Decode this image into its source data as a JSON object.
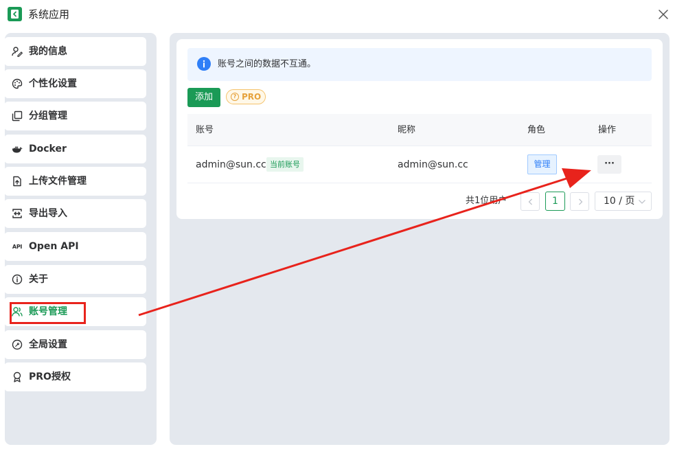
{
  "window": {
    "title": "系统应用",
    "close_icon": "close-icon",
    "logo_icon": "app-logo-icon"
  },
  "sidebar": {
    "items": [
      {
        "label": "我的信息",
        "icon": "user-edit-icon",
        "active": false
      },
      {
        "label": "个性化设置",
        "icon": "palette-icon",
        "active": false
      },
      {
        "label": "分组管理",
        "icon": "copy-icon",
        "active": false
      },
      {
        "label": "Docker",
        "icon": "docker-icon",
        "active": false
      },
      {
        "label": "上传文件管理",
        "icon": "upload-file-icon",
        "active": false
      },
      {
        "label": "导出导入",
        "icon": "export-import-icon",
        "active": false
      },
      {
        "label": "Open API",
        "icon": "api-icon",
        "icon_text": "API",
        "active": false
      },
      {
        "label": "关于",
        "icon": "info-icon",
        "active": false
      },
      {
        "label": "账号管理",
        "icon": "users-icon",
        "active": true
      },
      {
        "label": "全局设置",
        "icon": "wrench-icon",
        "active": false
      },
      {
        "label": "PRO授权",
        "icon": "award-icon",
        "active": false
      }
    ]
  },
  "main": {
    "notice": "账号之间的数据不互通。",
    "add_button": "添加",
    "pro_badge": "PRO",
    "pro_badge_icon_text": "?",
    "table": {
      "headers": [
        "账号",
        "昵称",
        "角色",
        "操作"
      ],
      "rows": [
        {
          "account": "admin@sun.cc",
          "current_tag": "当前账号",
          "nickname": "admin@sun.cc",
          "role": "管理",
          "action": "···"
        }
      ]
    },
    "pagination": {
      "total_text": "共1位用户",
      "current_page": "1",
      "page_size": "10 / 页"
    }
  },
  "colors": {
    "accent": "#1a9a56",
    "highlight": "#e8231c",
    "info": "#2f7ff7",
    "pro": "#e6a23c"
  }
}
